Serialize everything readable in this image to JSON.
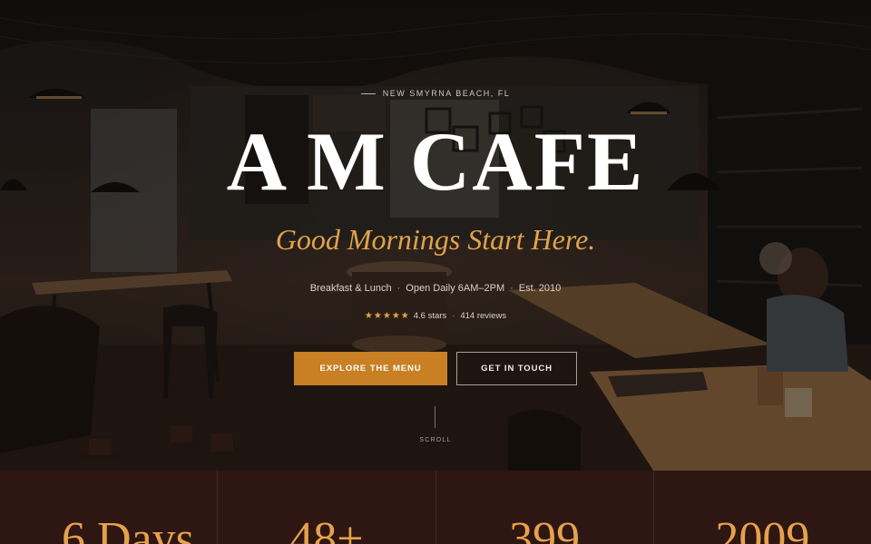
{
  "hero": {
    "eyebrow": "NEW SMYRNA BEACH, FL",
    "title": "A M CAFE",
    "tagline": "Good Mornings Start Here.",
    "meta": {
      "service": "Breakfast & Lunch",
      "hours": "Open Daily 6AM–2PM",
      "established": "Est. 2010"
    },
    "rating": {
      "stars_glyph": "★★★★★",
      "value": 4.6,
      "stars_text": "4.6 stars",
      "reviews_text": "414 reviews"
    },
    "buttons": {
      "primary": "EXPLORE THE MENU",
      "secondary": "GET IN TOUCH"
    },
    "scroll_label": "SCROLL"
  },
  "stats": [
    {
      "value": "6 Days"
    },
    {
      "value": "48+"
    },
    {
      "value": "399"
    },
    {
      "value": "2009"
    }
  ],
  "colors": {
    "accent": "#c97f24",
    "tagline": "#e0a24b",
    "stats_background": "#2e1613",
    "stat_value": "#e6a14c"
  }
}
